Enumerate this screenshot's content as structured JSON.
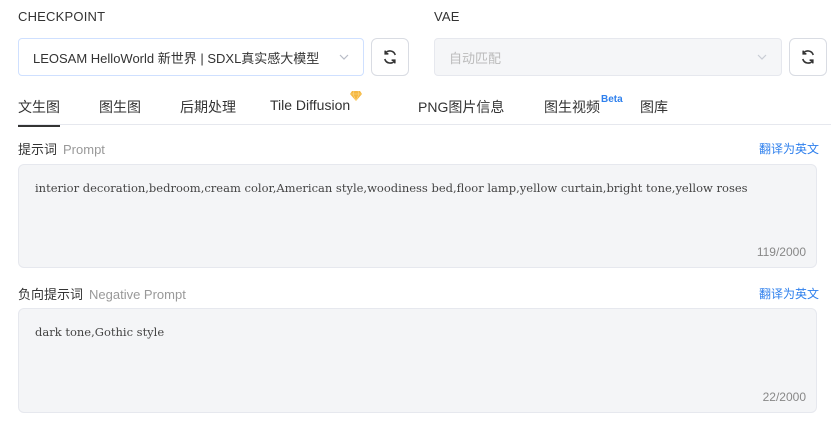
{
  "checkpoint": {
    "label": "CHECKPOINT",
    "value": "LEOSAM HelloWorld 新世界 | SDXL真实感大模型"
  },
  "vae": {
    "label": "VAE",
    "value": "自动匹配"
  },
  "tabs": [
    {
      "label": "文生图",
      "active": true
    },
    {
      "label": "图生图"
    },
    {
      "label": "后期处理"
    },
    {
      "label": "Tile Diffusion",
      "badge_icon": "gem-icon"
    },
    {
      "label": "PNG图片信息"
    },
    {
      "label": "图生视频",
      "sup": "Beta"
    },
    {
      "label": "图库"
    }
  ],
  "prompt": {
    "label_cn": "提示词",
    "label_en": "Prompt",
    "translate": "翻译为英文",
    "text": "interior decoration,bedroom,cream color,American style,woodiness bed,floor lamp,yellow curtain,bright tone,yellow roses",
    "counter": "119/2000"
  },
  "negative_prompt": {
    "label_cn": "负向提示词",
    "label_en": "Negative Prompt",
    "translate": "翻译为英文",
    "text": "dark tone,Gothic style",
    "counter": "22/2000"
  },
  "colors": {
    "accent": "#2f80ed",
    "textarea_bg": "#f4f5f7",
    "gem": "#f5b740"
  }
}
